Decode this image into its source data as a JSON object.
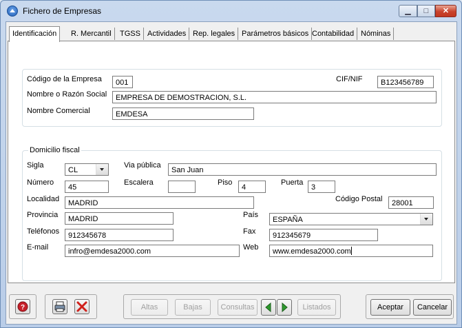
{
  "window": {
    "title": "Fichero de Empresas",
    "minimize_glyph": "▁",
    "maximize_glyph": "□",
    "close_glyph": "✕"
  },
  "tabs": [
    {
      "label": "Identificación",
      "active": true
    },
    {
      "label": "R. Mercantil"
    },
    {
      "label": "TGSS"
    },
    {
      "label": "Actividades"
    },
    {
      "label": "Rep. legales"
    },
    {
      "label": "Parámetros básicos"
    },
    {
      "label": "Contabilidad"
    },
    {
      "label": "Nóminas"
    }
  ],
  "identificacion": {
    "codigo_label": "Código de la Empresa",
    "codigo_value": "001",
    "cif_label": "CIF/NIF",
    "cif_value": "B123456789",
    "nombre_label": "Nombre o Razón Social",
    "nombre_value": "EMPRESA DE DEMOSTRACION, S.L.",
    "comercial_label": "Nombre Comercial",
    "comercial_value": "EMDESA"
  },
  "domicilio": {
    "legend": "Domicilio fiscal",
    "sigla_label": "Sigla",
    "sigla_value": "CL",
    "via_label": "Via pública",
    "via_value": "San Juan",
    "numero_label": "Número",
    "numero_value": "45",
    "escalera_label": "Escalera",
    "escalera_value": "",
    "piso_label": "Piso",
    "piso_value": "4",
    "puerta_label": "Puerta",
    "puerta_value": "3",
    "localidad_label": "Localidad",
    "localidad_value": "MADRID",
    "cp_label": "Código Postal",
    "cp_value": "28001",
    "provincia_label": "Provincia",
    "provincia_value": "MADRID",
    "pais_label": "País",
    "pais_value": "ESPAÑA",
    "telefonos_label": "Teléfonos",
    "telefonos_value": "912345678",
    "fax_label": "Fax",
    "fax_value": "912345679",
    "email_label": "E-mail",
    "email_value": "infro@emdesa2000.com",
    "web_label": "Web",
    "web_value": "www.emdesa2000.com"
  },
  "toolbar": {
    "altas": "Altas",
    "bajas": "Bajas",
    "consultas": "Consultas",
    "listados": "Listados",
    "aceptar": "Aceptar",
    "cancelar": "Cancelar"
  },
  "colors": {
    "accent": "#1f5fb8",
    "close_red": "#c2371f",
    "nav_green": "#2e9a2e"
  }
}
